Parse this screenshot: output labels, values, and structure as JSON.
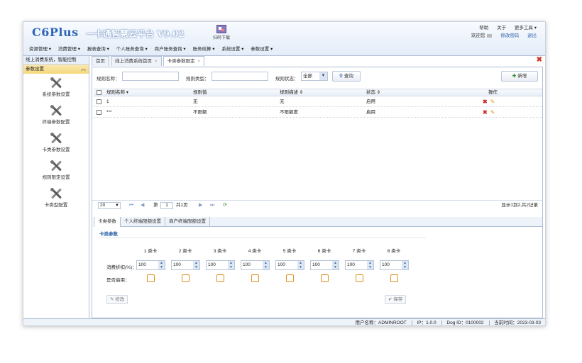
{
  "app": {
    "logo": "C6Plus",
    "subtitle": "一卡通智慧云平台 V9.02",
    "qr_label": "扫码下载"
  },
  "topbar": {
    "row1": [
      "帮助",
      "关于",
      "更多工具 ▾"
    ],
    "row2": [
      "欢迎您",
      "修改密码",
      "退出"
    ]
  },
  "menu": [
    "资源管理 ▾",
    "消费管理 ▾",
    "报表查询 ▾",
    "个人账务查询 ▾",
    "商户账务查询 ▾",
    "账务结算 ▾",
    "系统设置 ▾",
    "参数设置 ▾"
  ],
  "left": {
    "top_label": "线上消费系统，智能控制",
    "section": "参数设置",
    "items": [
      "系统参数设置",
      "终端参数配置",
      "卡类参数设置",
      "规则限定设置",
      "卡类型配置"
    ]
  },
  "tabs": [
    {
      "label": "首页",
      "active": false
    },
    {
      "label": "线上消费系统首页",
      "active": false
    },
    {
      "label": "卡类参数限定",
      "active": true
    }
  ],
  "search": {
    "field1_label": "规则名称：",
    "field2_label": "规则类型：",
    "status_label": "规则状态：",
    "status_value": "全部",
    "query_button": "查询",
    "add_button": "新增"
  },
  "grid": {
    "columns": [
      "规则名称",
      "规则值",
      "规则描述",
      "状态",
      "操作"
    ],
    "rows": [
      {
        "name": "1",
        "value": "无",
        "desc": "无",
        "status": "启用"
      },
      {
        "name": "***",
        "value": "不限额",
        "desc": "不限额度",
        "status": "启用"
      }
    ]
  },
  "pager": {
    "page_size": "20",
    "page_prefix": "第",
    "page_value": "1",
    "page_suffix": "共1页",
    "info": "显示1到2,共2记录"
  },
  "subtabs": [
    {
      "label": "卡类参数",
      "active": true
    },
    {
      "label": "个人终端限额设置",
      "active": false
    },
    {
      "label": "商户终端限额设置",
      "active": false
    }
  ],
  "panel": {
    "title": "卡类参数",
    "columns": [
      "1 类卡",
      "2 类卡",
      "3 类卡",
      "4 类卡",
      "5 类卡",
      "6 类卡",
      "7 类卡",
      "8 类卡"
    ],
    "limit_label": "消费折扣(%)：",
    "limit_values": [
      "100",
      "100",
      "100",
      "100",
      "100",
      "100",
      "100",
      "100"
    ],
    "enable_label": "是否启用：",
    "modify_button": "修改",
    "save_button": "保存"
  },
  "status": {
    "items": [
      "用户名称：ADMINROOT",
      "IP：1.0.0",
      "Dog ID：0100002",
      "当前时间：2023-03-03"
    ]
  }
}
